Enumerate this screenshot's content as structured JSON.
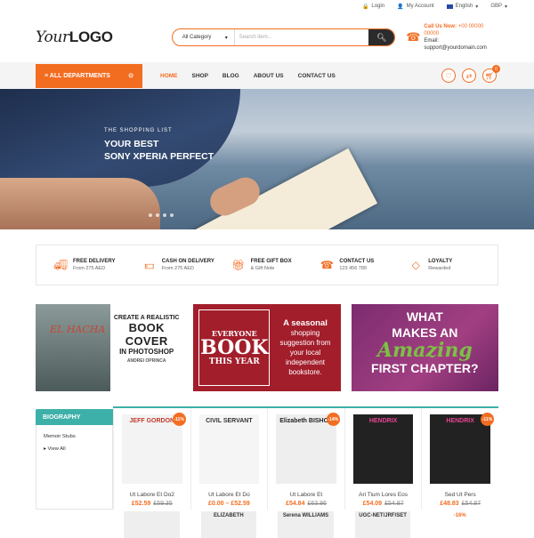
{
  "topbar": {
    "login": "Login",
    "account": "My Account",
    "language": "English",
    "currency": "GBP"
  },
  "header": {
    "logo_your": "Your",
    "logo_logo": "LOGO",
    "category": "All Category",
    "search_placeholder": "Search item...",
    "call_label": "Call Us Now:",
    "call_number": "+00 00000 00000",
    "email": "Email: support@yourdomain.com"
  },
  "nav": {
    "all_departments": "ALL DEPARTMENTS",
    "items": [
      "HOME",
      "SHOP",
      "BLOG",
      "ABOUT US",
      "CONTACT US"
    ],
    "cart_count": "0"
  },
  "hero": {
    "small": "THE SHOPPING LIST",
    "line1": "YOUR BEST",
    "line2": "SONY XPERIA PERFECT"
  },
  "features": [
    {
      "title": "FREE DELIVERY",
      "sub": "From 275 AED",
      "icon": "truck-icon"
    },
    {
      "title": "CASH ON DELIVERY",
      "sub": "From 275 AED",
      "icon": "cash-icon"
    },
    {
      "title": "FREE GIFT BOX",
      "sub": "& Gift Note",
      "icon": "gift-icon"
    },
    {
      "title": "CONTACT US",
      "sub": "123 456 789",
      "icon": "phone-icon"
    },
    {
      "title": "LOYALTY",
      "sub": "Rewarded",
      "icon": "diamond-icon"
    }
  ],
  "banners": {
    "b1": {
      "book_title": "EL HACHA",
      "l1": "CREATE A REALISTIC",
      "l2": "BOOK COVER",
      "l3": "IN PHOTOSHOP",
      "l4": "ANDREI OPRINCA"
    },
    "b2": {
      "a": "EVERYONE",
      "b": "BOOK",
      "c": "THIS YEAR",
      "h": "A seasonal",
      "t": "shopping suggestion from your local independent bookstore."
    },
    "b3": {
      "w1": "WHAT",
      "w2": "MAKES AN",
      "am": "Amazing",
      "fc": "FIRST CHAPTER?"
    }
  },
  "sidebar": {
    "title": "BIOGRAPHY",
    "items": [
      "Memoir Stubs",
      "View All"
    ]
  },
  "products": [
    {
      "name": "Ut Labore Et Do2",
      "price": "£52.59",
      "old": "£59.35",
      "disc": "-11%",
      "cover": "JEFF GORDON",
      "bg": "#f3f3f3",
      "fg": "#c0392b"
    },
    {
      "name": "Ut Labore Et Do",
      "price": "£0.00 – £52.59",
      "old": "",
      "disc": "",
      "cover": "CIVIL SERVANT",
      "bg": "#f5f5f5",
      "fg": "#333"
    },
    {
      "name": "Ut Labore Et",
      "price": "£54.84",
      "old": "£63.86",
      "disc": "-14%",
      "cover": "Elizabeth BISHOP",
      "bg": "#eeeeee",
      "fg": "#222"
    },
    {
      "name": "Ari Tium Lores Eos",
      "price": "£54.09",
      "old": "£54.87",
      "disc": "",
      "cover": "HENDRIX",
      "bg": "#222",
      "fg": "#e84393"
    },
    {
      "name": "Sed Ut Pers",
      "price": "£48.83",
      "old": "£54.87",
      "disc": "-11%",
      "cover": "HENDRIX",
      "bg": "#222",
      "fg": "#e84393"
    }
  ],
  "row2": [
    "",
    "ELIZABETH",
    "Serena WILLIAMS",
    "UGC-NET/JRF/SET",
    "-16%"
  ]
}
